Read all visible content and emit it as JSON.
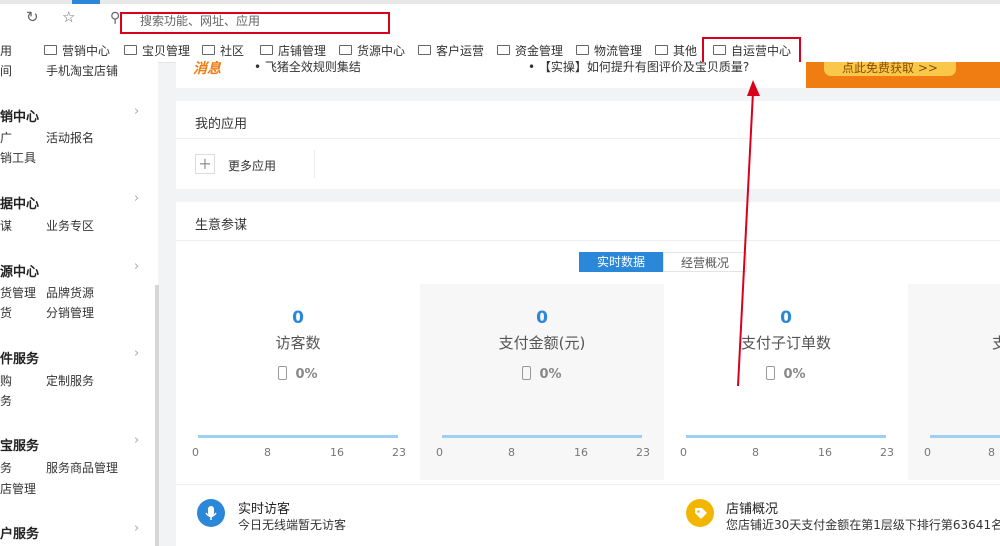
{
  "browser": {
    "refresh_icon": "refresh-icon",
    "bookmark_icon": "bookmark-icon",
    "search_icon": "search-icon",
    "search_placeholder": "搜索功能、网址、应用",
    "bookmarks_lead": "用",
    "bookmarks": [
      "营销中心",
      "宝贝管理",
      "社区",
      "店铺管理",
      "货源中心",
      "客户运营",
      "资金管理",
      "物流管理",
      "其他",
      "自运营中心"
    ]
  },
  "sidebar": {
    "top_items": [
      "间",
      "手机淘宝店铺"
    ],
    "sections": [
      {
        "title": "销中心",
        "items": [
          "广",
          "活动报名",
          "销工具"
        ]
      },
      {
        "title": "据中心",
        "items": [
          "谋",
          "业务专区"
        ]
      },
      {
        "title": "源中心",
        "items": [
          "货管理",
          "品牌货源",
          "货",
          "分销管理"
        ]
      },
      {
        "title": "件服务",
        "items": [
          "购",
          "定制服务",
          "务"
        ]
      },
      {
        "title": "宝服务",
        "items": [
          "务",
          "服务商品管理",
          "店管理"
        ]
      },
      {
        "title": "户服务",
        "items": []
      }
    ]
  },
  "notice": {
    "left_tag": "消息",
    "item1": "• 飞猪全效规则集结",
    "item2": "• 【实操】如何提升有图评价及宝贝质量?",
    "promo_button": "点此免费获取 >>"
  },
  "my_apps": {
    "title": "我的应用",
    "more_label": "更多应用"
  },
  "business": {
    "title": "生意参谋",
    "tabs": [
      "实时数据",
      "经营概况"
    ],
    "active_tab": 0,
    "metrics": [
      {
        "value": "0",
        "label": "访客数",
        "pct": "0%"
      },
      {
        "value": "0",
        "label": "支付金额(元)",
        "pct": "0%"
      },
      {
        "value": "0",
        "label": "支付子订单数",
        "pct": "0%"
      },
      {
        "value": "",
        "label": "支",
        "pct": ""
      }
    ],
    "axis_ticks": [
      "0",
      "8",
      "16",
      "23"
    ]
  },
  "bottom": {
    "realtime_title": "实时访客",
    "realtime_text": "今日无线端暂无访客",
    "shop_title": "店铺概况",
    "shop_text": "您店铺近30天支付金额在第1层级下排行第63641名,"
  },
  "colors": {
    "accent": "#2b88d8",
    "highlight": "#d9001b",
    "promo": "#f07d11"
  }
}
